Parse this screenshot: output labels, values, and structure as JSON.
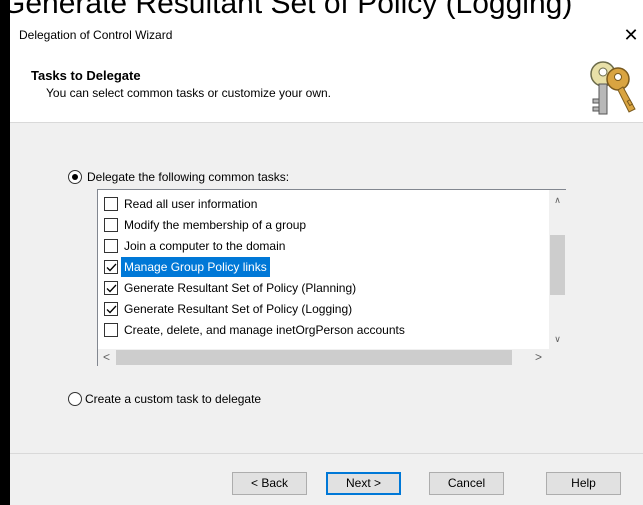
{
  "background": {
    "caption": "Generate Resultant Set of Policy (Logging)"
  },
  "window": {
    "title": "Delegation of Control Wizard",
    "close_glyph": "✕"
  },
  "header": {
    "title": "Tasks to Delegate",
    "subtitle": "You can select common tasks or customize your own.",
    "icon": "keys-icon"
  },
  "options": {
    "common_label": "Delegate the following common tasks:",
    "common_selected": true,
    "custom_label": "Create a custom task to delegate",
    "custom_selected": false
  },
  "tasks": [
    {
      "label": "Read all user information",
      "checked": false,
      "selected": false
    },
    {
      "label": "Modify the membership of a group",
      "checked": false,
      "selected": false
    },
    {
      "label": "Join a computer to the domain",
      "checked": false,
      "selected": false
    },
    {
      "label": "Manage Group Policy links",
      "checked": true,
      "selected": true
    },
    {
      "label": "Generate Resultant Set of Policy (Planning)",
      "checked": true,
      "selected": false
    },
    {
      "label": "Generate Resultant Set of Policy (Logging)",
      "checked": true,
      "selected": false
    },
    {
      "label": "Create, delete, and manage inetOrgPerson accounts",
      "checked": false,
      "selected": false
    }
  ],
  "scrollbar": {
    "up": "∧",
    "down": "∨",
    "left": "<",
    "right": ">"
  },
  "buttons": {
    "back": "< Back",
    "next": "Next >",
    "cancel": "Cancel",
    "help": "Help"
  },
  "colors": {
    "selection": "#0078d7",
    "panel": "#f0f0f0"
  }
}
